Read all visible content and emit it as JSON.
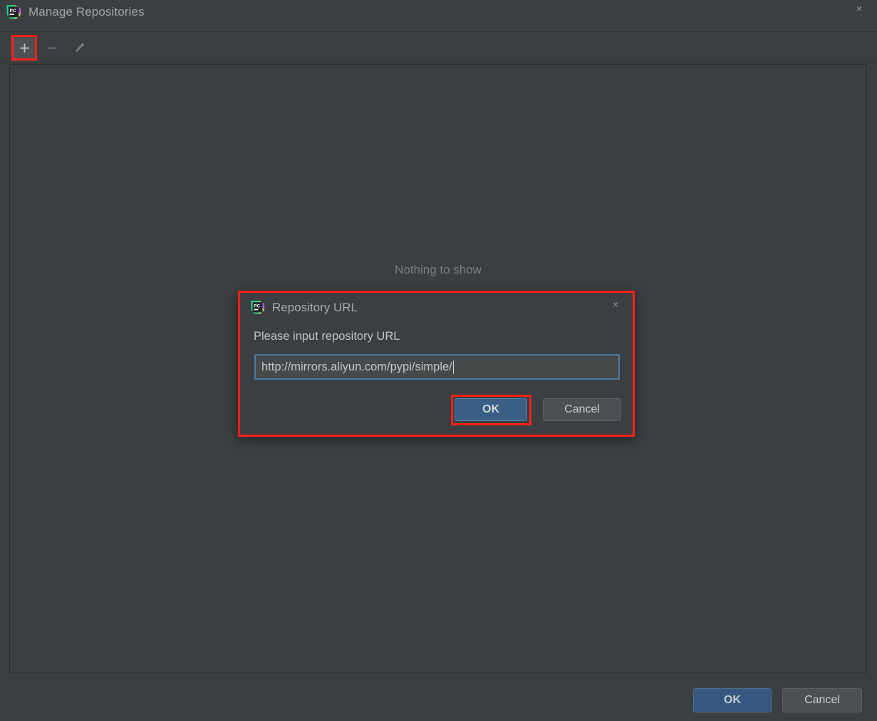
{
  "window": {
    "title": "Manage Repositories",
    "icon": "pycharm-icon",
    "close_label": "×"
  },
  "toolbar": {
    "add_label": "+",
    "add_icon": "plus-icon",
    "remove_label": "–",
    "remove_icon": "minus-icon",
    "edit_icon": "pencil-icon"
  },
  "list": {
    "empty_text": "Nothing to show"
  },
  "footer": {
    "ok_label": "OK",
    "cancel_label": "Cancel"
  },
  "dialog": {
    "title": "Repository URL",
    "icon": "pycharm-icon",
    "close_label": "×",
    "prompt": "Please input repository URL",
    "input_value": "http://mirrors.aliyun.com/pypi/simple/",
    "input_placeholder": "",
    "ok_label": "OK",
    "cancel_label": "Cancel"
  },
  "colors": {
    "background": "#3c3f41",
    "panel_border": "#2b2d2e",
    "accent_blue": "#365880",
    "focus_border": "#4a7aa5",
    "annotation_red": "#ff2018",
    "text": "#bbbbbb",
    "muted_text": "#7a7d80"
  }
}
